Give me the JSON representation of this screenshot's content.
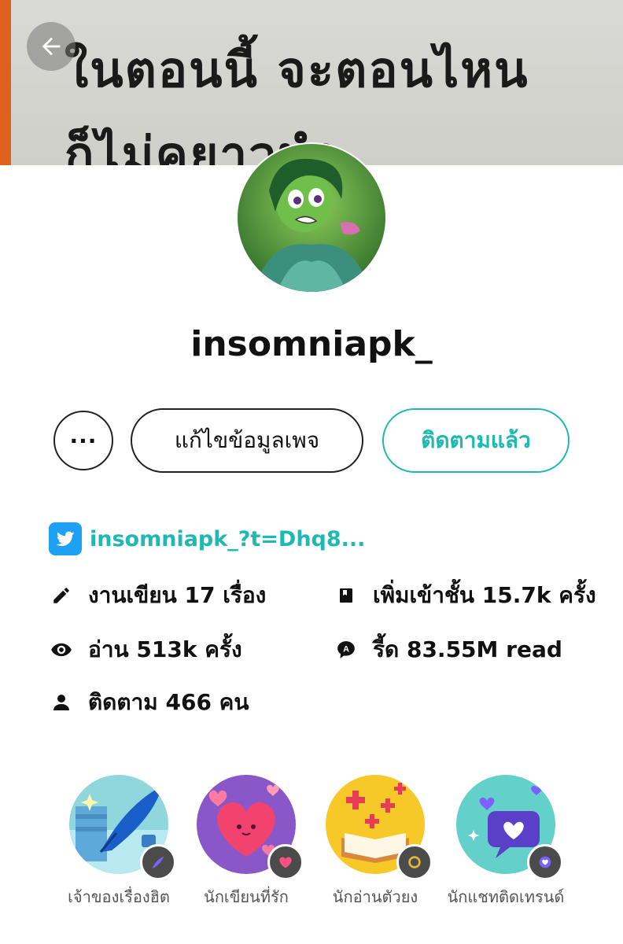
{
  "cover": {
    "line1": "ในตอนนี้  จะตอนไหน",
    "line2": "ก็ไม่คยาวนำ"
  },
  "profile": {
    "username": "insomniapk_"
  },
  "actions": {
    "more_label": "···",
    "edit_label": "แก้ไขข้อมูลเพจ",
    "follow_label": "ติดตามแล้ว"
  },
  "twitter": {
    "link": "insomniapk_?t=Dhq8..."
  },
  "stats": {
    "works": "งานเขียน 17 เรื่อง",
    "library": "เพิ่มเข้าชั้น 15.7k ครั้ง",
    "reads": "อ่าน 513k ครั้ง",
    "read_time": "รี้ด 83.55M read",
    "followers": "ติดตาม 466 คน"
  },
  "badges": [
    {
      "label": "เจ้าของเรื่องฮิต",
      "icon": "quill-pen-icon"
    },
    {
      "label": "นักเขียนที่รัก",
      "icon": "heart-icon"
    },
    {
      "label": "นักอ่านตัวยง",
      "icon": "open-book-icon"
    },
    {
      "label": "นักแชทติดเทรนด์",
      "icon": "chat-heart-icon"
    }
  ],
  "colors": {
    "accent": "#1fb9b3",
    "twitter": "#1da1f2",
    "cover_strip": "#e2601d"
  }
}
